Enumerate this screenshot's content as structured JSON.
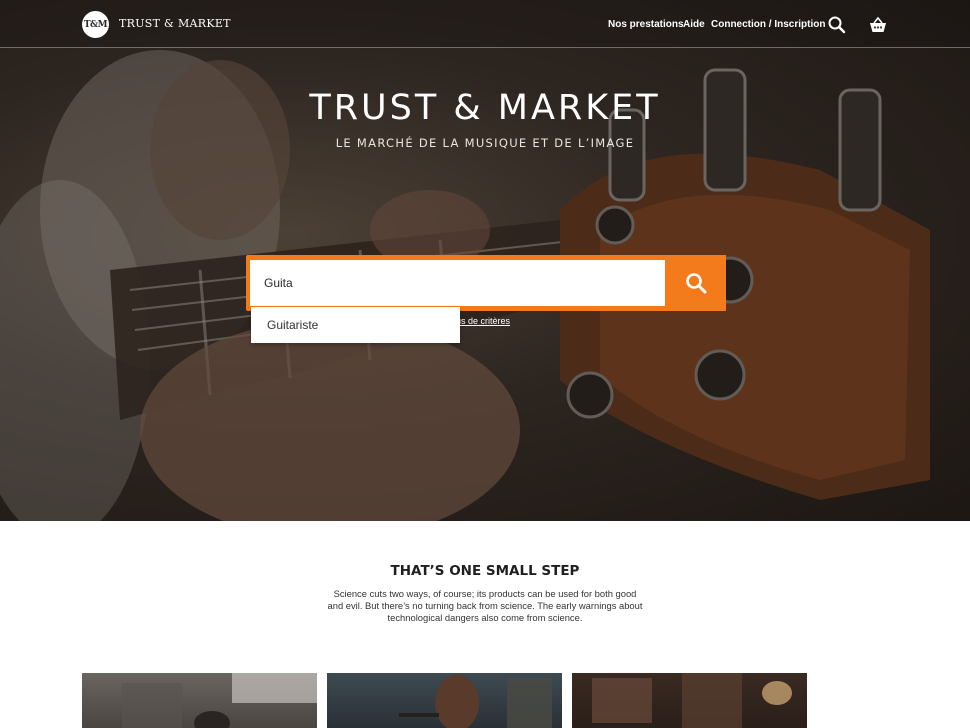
{
  "header": {
    "logo_text": "T&M",
    "brand": "TRUST & MARKET",
    "nav": {
      "prestations": "Nos prestations",
      "aide": "Aide",
      "connection": "Connection / Inscription"
    },
    "icons": {
      "search": "search-icon",
      "basket": "basket-icon"
    }
  },
  "hero": {
    "title": "TRUST & MARKET",
    "subtitle": "LE MARCHÉ DE LA MUSIQUE ET DE L’IMAGE",
    "search": {
      "value": "Guita",
      "submit_icon": "search-icon",
      "accent_color": "#f37b1b"
    },
    "more_criteria": "us de critères",
    "autocomplete": [
      "Guitariste"
    ]
  },
  "section": {
    "title": "THAT’S ONE SMALL STEP",
    "body": "Science cuts two ways, of course; its products can be used for both good and evil. But there’s no turning back from science. The early warnings about technological dangers also come from science."
  }
}
